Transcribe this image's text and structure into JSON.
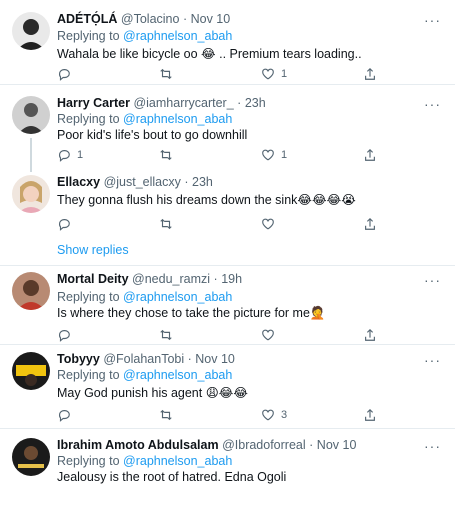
{
  "tweets": [
    {
      "name": "ADÉTỌ́LÁ",
      "handle": "@Tolacino",
      "time": "Nov 10",
      "replying_prefix": "Replying to ",
      "replying_to": "@raphnelson_abah",
      "text": "Wahala be like bicycle oo 😂 .. Premium tears loading..",
      "reply_count": "",
      "retweet_count": "",
      "like_count": "1"
    },
    {
      "name": "Harry Carter",
      "handle": "@iamharrycarter_",
      "time": "23h",
      "replying_prefix": "Replying to ",
      "replying_to": "@raphnelson_abah",
      "text": "Poor kid's life's bout to go downhill",
      "reply_count": "1",
      "retweet_count": "",
      "like_count": "1"
    },
    {
      "name": "Ellacxy",
      "handle": "@just_ellacxy",
      "time": "23h",
      "text": "They gonna flush his dreams down the sink😂😂😂😭",
      "reply_count": "",
      "retweet_count": "",
      "like_count": ""
    },
    {
      "name": "Mortal Deity",
      "handle": "@nedu_ramzi",
      "time": "19h",
      "replying_prefix": "Replying to ",
      "replying_to": "@raphnelson_abah",
      "text": "Is where they chose to take the picture for me🤦",
      "reply_count": "",
      "retweet_count": "",
      "like_count": ""
    },
    {
      "name": "Tobyyy",
      "handle": "@FolahanTobi",
      "time": "Nov 10",
      "replying_prefix": "Replying to ",
      "replying_to": "@raphnelson_abah",
      "text": "May God punish his agent 😩😂😂",
      "reply_count": "",
      "retweet_count": "",
      "like_count": "3"
    },
    {
      "name": "Ibrahim Amoto Abdulsalam",
      "handle": "@Ibradoforreal",
      "time": "Nov 10",
      "replying_prefix": "Replying to ",
      "replying_to": "@raphnelson_abah",
      "text": "Jealousy is the root of hatred. Edna Ogoli"
    }
  ],
  "dot": "·",
  "show_replies": "Show replies",
  "more_glyph": "···"
}
